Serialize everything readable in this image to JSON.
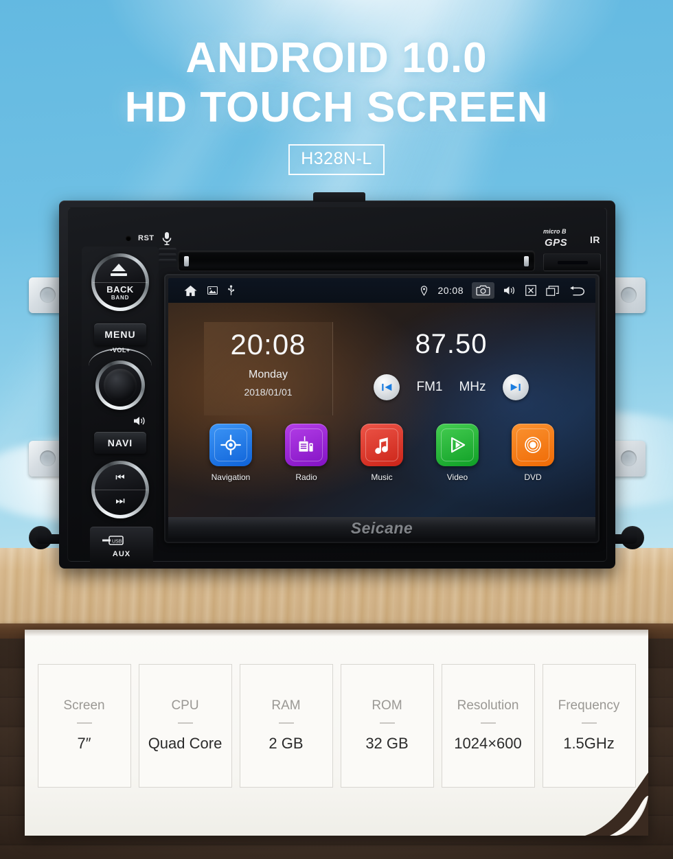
{
  "hero": {
    "headline_line1": "ANDROID 10.0",
    "headline_line2": "HD TOUCH SCREEN",
    "model_badge": "H328N-L",
    "sky_color": "#63b9e1",
    "headline_color": "#ffffff"
  },
  "device": {
    "brand": "Seicane",
    "top_labels": {
      "reset": "RST",
      "micro_sd": "micro    B",
      "gps": "GPS",
      "ir": "IR"
    },
    "controls": {
      "back_band_primary": "BACK",
      "back_band_secondary": "BAND",
      "menu": "MENU",
      "navi": "NAVI",
      "volume": "-VOL+",
      "aux": "AUX"
    }
  },
  "screen": {
    "statusbar": {
      "left_icons": [
        "home-icon",
        "gallery-icon",
        "usb-icon"
      ],
      "location_icon": "location-pin-icon",
      "time": "20:08",
      "right_icons": [
        "camera-icon",
        "volume-icon",
        "close-icon",
        "recents-icon",
        "back-icon"
      ],
      "highlighted_icon": "camera-icon"
    },
    "clock_widget": {
      "time": "20:08",
      "weekday": "Monday",
      "date": "2018/01/01"
    },
    "radio_widget": {
      "frequency": "87.50",
      "band": "FM1",
      "unit": "MHz",
      "prev_icon": "skip-previous-icon",
      "next_icon": "skip-next-icon"
    },
    "apps": [
      {
        "label": "Navigation",
        "icon": "navigation-target-icon",
        "color": "#1e7ef0"
      },
      {
        "label": "Radio",
        "icon": "radio-icon",
        "color": "#9b1fd8"
      },
      {
        "label": "Music",
        "icon": "music-note-icon",
        "color": "#e03b2f"
      },
      {
        "label": "Video",
        "icon": "video-play-icon",
        "color": "#23b33a"
      },
      {
        "label": "DVD",
        "icon": "dvd-disc-icon",
        "color": "#f57c12"
      }
    ]
  },
  "specs": [
    {
      "label": "Screen",
      "value": "7″"
    },
    {
      "label": "CPU",
      "value": "Quad Core"
    },
    {
      "label": "RAM",
      "value": "2 GB"
    },
    {
      "label": "ROM",
      "value": "32 GB"
    },
    {
      "label": "Resolution",
      "value": "1024×600"
    },
    {
      "label": "Frequency",
      "value": "1.5GHz"
    }
  ]
}
